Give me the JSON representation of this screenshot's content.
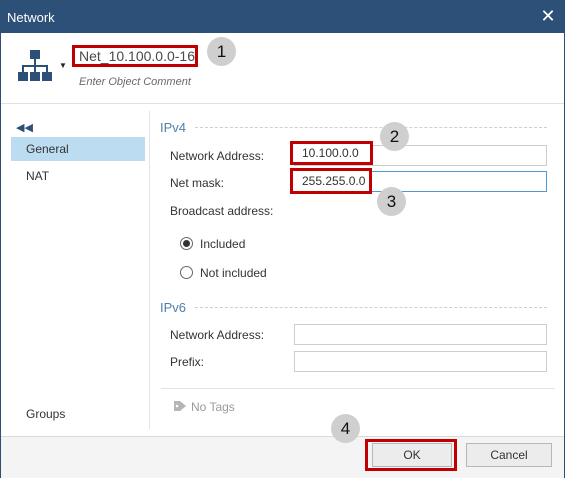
{
  "window": {
    "title": "Network"
  },
  "header": {
    "object_name": "Net_10.100.0.0-16",
    "comment_placeholder": "Enter Object Comment"
  },
  "callouts": [
    "1",
    "2",
    "3",
    "4"
  ],
  "sidebar": {
    "items": [
      {
        "label": "General",
        "active": true
      },
      {
        "label": "NAT",
        "active": false
      }
    ],
    "bottom_item": "Groups"
  },
  "ipv4": {
    "title": "IPv4",
    "network_address_label": "Network Address:",
    "network_address_value": "10.100.0.0",
    "net_mask_label": "Net mask:",
    "net_mask_value": "255.255.0.0",
    "broadcast_label": "Broadcast address:",
    "broadcast_options": [
      "Included",
      "Not included"
    ],
    "broadcast_selected": "Included"
  },
  "ipv6": {
    "title": "IPv6",
    "network_address_label": "Network Address:",
    "network_address_value": "",
    "prefix_label": "Prefix:",
    "prefix_value": ""
  },
  "tags": {
    "label": "No Tags"
  },
  "footer": {
    "ok_label": "OK",
    "cancel_label": "Cancel"
  },
  "colors": {
    "titlebar": "#2c5077",
    "accent": "#4f7fab",
    "highlight": "#c00000",
    "selection": "#bcdcf1"
  }
}
